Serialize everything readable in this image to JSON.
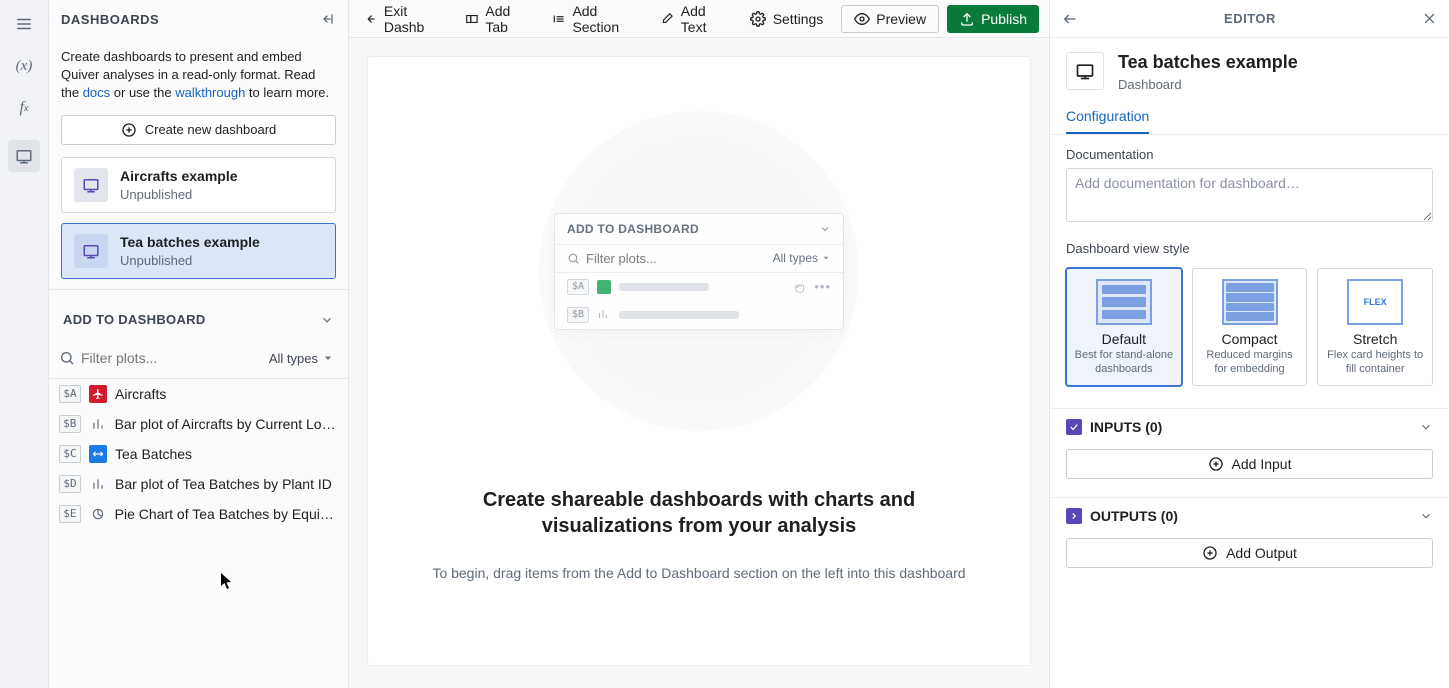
{
  "left": {
    "header": "DASHBOARDS",
    "intro_a": "Create dashboards to present and embed Quiver analyses in a read-only format. Read the ",
    "docs": "docs",
    "intro_b": " or use the ",
    "walkthrough": "walkthrough",
    "intro_c": " to learn more.",
    "create": "Create new dashboard",
    "cards": [
      {
        "title": "Aircrafts example",
        "status": "Unpublished"
      },
      {
        "title": "Tea batches example",
        "status": "Unpublished"
      }
    ],
    "add_header": "ADD TO DASHBOARD",
    "filter_placeholder": "Filter plots...",
    "types_label": "All types",
    "plots": [
      {
        "key": "$A",
        "name": "Aircrafts"
      },
      {
        "key": "$B",
        "name": "Bar plot of Aircrafts by Current Loc…"
      },
      {
        "key": "$C",
        "name": "Tea Batches"
      },
      {
        "key": "$D",
        "name": "Bar plot of Tea Batches by Plant ID"
      },
      {
        "key": "$E",
        "name": "Pie Chart of Tea Batches by Equip…"
      }
    ]
  },
  "toolbar": {
    "exit": "Exit Dashb",
    "add_tab": "Add Tab",
    "add_section": "Add Section",
    "add_text": "Add Text",
    "settings": "Settings",
    "preview": "Preview",
    "publish": "Publish"
  },
  "placeholder": {
    "mini_add": "ADD TO DASHBOARD",
    "mini_filter": "Filter plots...",
    "mini_types": "All types",
    "key_a": "$A",
    "key_b": "$B",
    "title": "Create shareable dashboards with charts and visualizations from your analysis",
    "sub": "To begin, drag items from the Add to Dashboard section on the left into this dashboard"
  },
  "editor": {
    "header": "EDITOR",
    "name": "Tea batches example",
    "kind": "Dashboard",
    "tab_config": "Configuration",
    "doc_label": "Documentation",
    "doc_placeholder": "Add documentation for dashboard…",
    "view_style_label": "Dashboard view style",
    "styles": [
      {
        "name": "Default",
        "desc": "Best for stand-alone dashboards"
      },
      {
        "name": "Compact",
        "desc": "Reduced margins for embedding"
      },
      {
        "name": "Stretch",
        "desc": "Flex card heights to fill container"
      }
    ],
    "flex_label": "FLEX",
    "inputs_label": "INPUTS (0)",
    "add_input": "Add Input",
    "outputs_label": "OUTPUTS (0)",
    "add_output": "Add Output"
  }
}
